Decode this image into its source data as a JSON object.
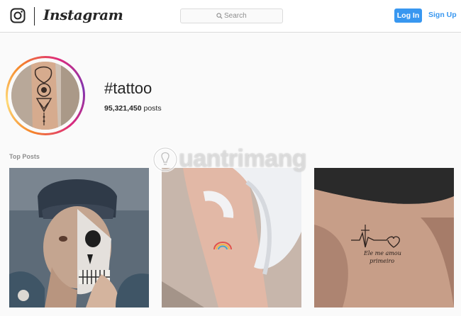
{
  "header": {
    "logo_word": "Instagram",
    "search": {
      "placeholder": "Search",
      "value": ""
    },
    "login_label": "Log In",
    "signup_label": "Sign Up",
    "icons": [
      "instagram-glyph-icon",
      "search-icon"
    ]
  },
  "profile": {
    "hashtag": "#tattoo",
    "post_count": "95,321,450",
    "post_count_label": " posts"
  },
  "top_posts": {
    "label": "Top Posts",
    "items": [
      {
        "name": "skull-face-tattoo-post"
      },
      {
        "name": "rainbow-mini-tattoo-post"
      },
      {
        "name": "heartbeat-script-tattoo-post",
        "script_line1": "Ele me amou",
        "script_line2": "primeiro"
      }
    ]
  },
  "watermark": {
    "text": "uantrimang"
  },
  "colors": {
    "accent": "#3897f0",
    "border": "#dbdbdb",
    "text": "#262626",
    "muted": "#8e8e8e",
    "background": "#fafafa"
  }
}
